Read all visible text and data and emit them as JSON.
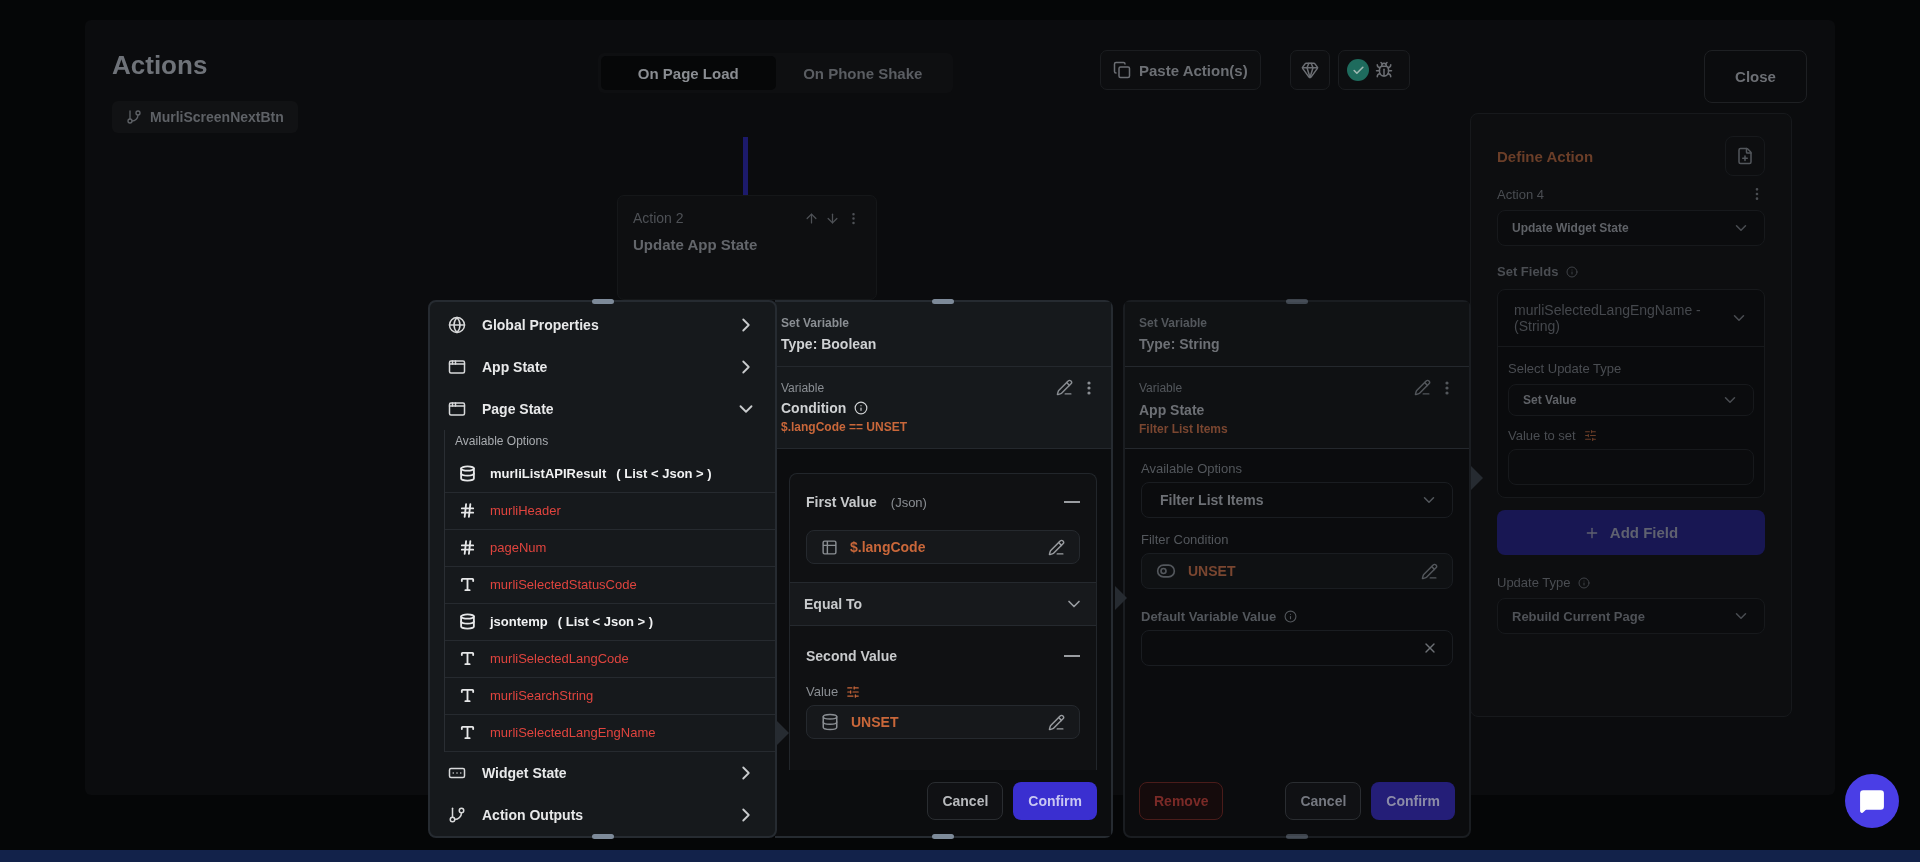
{
  "header": {
    "title": "Actions",
    "trigger_chip": "MurliScreenNextBtn"
  },
  "tabs": [
    {
      "label": "On Page Load",
      "selected": true
    },
    {
      "label": "On Phone Shake",
      "selected": false
    }
  ],
  "toolbar": {
    "paste_button": "Paste Action(s)",
    "validated": true
  },
  "close_button": "Close",
  "action_card": {
    "label": "Action 2",
    "title": "Update App State"
  },
  "variable_menu": {
    "sections": [
      {
        "kind": "global",
        "label": "Global Properties",
        "expanded": false
      },
      {
        "kind": "app",
        "label": "App State",
        "expanded": false
      },
      {
        "kind": "page",
        "label": "Page State",
        "expanded": true,
        "options_label": "Available Options",
        "options": [
          {
            "kind": "list",
            "name": "murliListAPIResult",
            "type": "( List < Json > )"
          },
          {
            "kind": "number",
            "name": "murliHeader"
          },
          {
            "kind": "number",
            "name": "pageNum"
          },
          {
            "kind": "text",
            "name": "murliSelectedStatusCode"
          },
          {
            "kind": "list",
            "name": "jsontemp",
            "type": "( List < Json > )"
          },
          {
            "kind": "text",
            "name": "murliSelectedLangCode"
          },
          {
            "kind": "text",
            "name": "murliSearchString"
          },
          {
            "kind": "text",
            "name": "murliSelectedLangEngName"
          }
        ]
      },
      {
        "kind": "widget",
        "label": "Widget State",
        "expanded": false
      },
      {
        "kind": "outputs",
        "label": "Action Outputs",
        "expanded": false
      }
    ]
  },
  "boolean_panel": {
    "header_label": "Set Variable",
    "type": "Type: Boolean",
    "variable_label": "Variable",
    "variable_name": "Condition",
    "expression": "$.langCode == UNSET",
    "first_value": {
      "label": "First Value",
      "type": "(Json)",
      "value": "$.langCode"
    },
    "operator": "Equal To",
    "second_value": {
      "label": "Second Value",
      "value_label": "Value",
      "value": "UNSET"
    },
    "buttons": [
      {
        "kind": "secondary",
        "label": "Cancel"
      },
      {
        "kind": "primary",
        "label": "Confirm"
      }
    ]
  },
  "string_panel": {
    "header_label": "Set Variable",
    "type": "Type: String",
    "variable_label": "Variable",
    "variable_name": "App State",
    "subtitle": "Filter List Items",
    "options_label": "Available Options",
    "option": "Filter List Items",
    "filter_label": "Filter Condition",
    "filter_value": "UNSET",
    "default_label": "Default Variable Value",
    "buttons": [
      {
        "kind": "danger",
        "label": "Remove"
      },
      {
        "kind": "secondary",
        "label": "Cancel"
      },
      {
        "kind": "primary",
        "label": "Confirm"
      }
    ]
  },
  "define_action": {
    "title": "Define Action",
    "action_label": "Action 4",
    "action_type": "Update Widget State",
    "set_fields_label": "Set Fields",
    "field": "murliSelectedLangEngName - (String)",
    "update_type_label": "Select Update Type",
    "update_type": "Set Value",
    "value_label": "Value to set",
    "add_field": "Add Field",
    "rebuild_label": "Update Type",
    "rebuild": "Rebuild Current Page"
  }
}
